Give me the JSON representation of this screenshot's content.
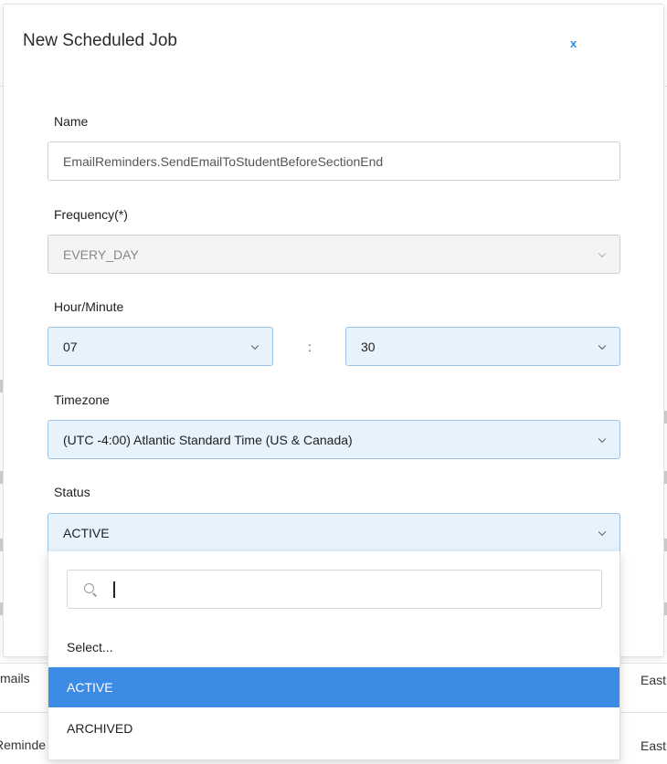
{
  "background": {
    "rows": [
      {
        "left": "mails",
        "right": "East"
      },
      {
        "left": "Reminde",
        "right": "East"
      }
    ]
  },
  "modal": {
    "title": "New Scheduled Job",
    "close_label": "x"
  },
  "form": {
    "name": {
      "label": "Name",
      "value": "EmailReminders.SendEmailToStudentBeforeSectionEnd"
    },
    "frequency": {
      "label": "Frequency(*)",
      "value": "EVERY_DAY"
    },
    "hour_minute": {
      "label": "Hour/Minute",
      "hour": "07",
      "separator": ":",
      "minute": "30"
    },
    "timezone": {
      "label": "Timezone",
      "value": "(UTC -4:00) Atlantic Standard Time (US & Canada)"
    },
    "status": {
      "label": "Status",
      "value": "ACTIVE"
    }
  },
  "status_dropdown": {
    "search_value": "",
    "options": [
      {
        "label": "Select...",
        "highlighted": false
      },
      {
        "label": "ACTIVE",
        "highlighted": true
      },
      {
        "label": "ARCHIVED",
        "highlighted": false
      }
    ]
  },
  "colors": {
    "accent": "#3c8ce6",
    "select_background": "#e6f2fc",
    "close_icon": "#2b8fe0"
  }
}
